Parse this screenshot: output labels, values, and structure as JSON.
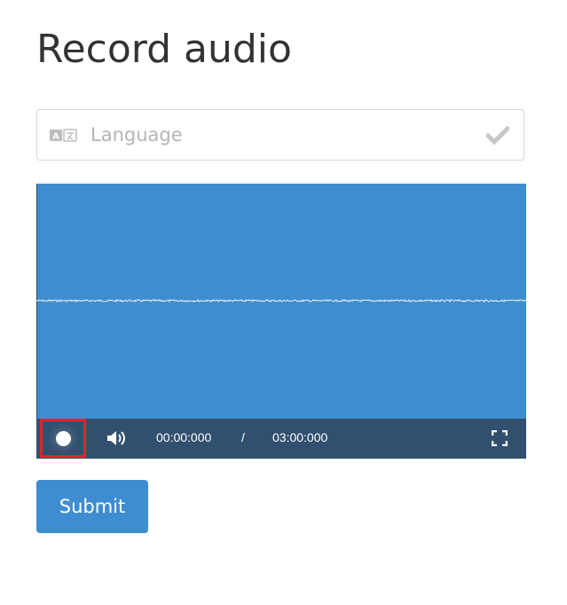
{
  "page": {
    "title": "Record audio"
  },
  "language_field": {
    "placeholder": "Language",
    "value": "",
    "icon": "translate-icon",
    "status_icon": "check-icon"
  },
  "player": {
    "background_color": "#3e8dd0",
    "controls_color": "#31506f",
    "record_icon": "record-icon",
    "volume_icon": "volume-icon",
    "fullscreen_icon": "fullscreen-icon",
    "current_time": "00:00:000",
    "separator": "/",
    "total_time": "03:00:000"
  },
  "submit": {
    "label": "Submit",
    "color": "#3e8dd0"
  }
}
